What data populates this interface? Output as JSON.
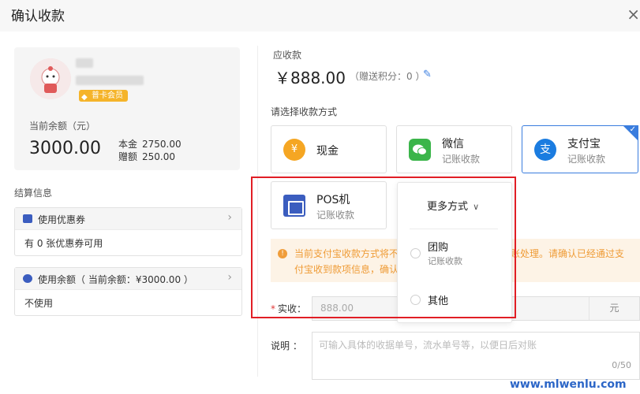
{
  "header": {
    "title": "确认收款",
    "close_label": "×"
  },
  "member": {
    "vip_label": "普卡会员",
    "balance_label": "当前余额（元）",
    "balance_value": "3000.00",
    "principal_label": "本金",
    "principal_value": "2750.00",
    "gift_label": "赠额",
    "gift_value": "250.00"
  },
  "settlement": {
    "label": "结算信息",
    "coupon": {
      "title": "使用优惠券",
      "body": "有 0 张优惠券可用"
    },
    "balance": {
      "title": "使用余额（ 当前余额：¥3000.00 ）",
      "body": "不使用"
    }
  },
  "due": {
    "label": "应收款",
    "amount": "￥888.00",
    "points": "（赠送积分：0 ）"
  },
  "payment": {
    "label": "请选择收款方式",
    "methods": [
      {
        "name": "现金",
        "sub": "",
        "icon": "yuan-icon",
        "color": "#f5a623"
      },
      {
        "name": "微信",
        "sub": "记账收款",
        "icon": "wechat-icon",
        "color": "#3bb54a"
      },
      {
        "name": "支付宝",
        "sub": "记账收款",
        "icon": "alipay-icon",
        "color": "#1b7ce0",
        "selected": true
      },
      {
        "name": "POS机",
        "sub": "记账收款",
        "icon": "pos-icon",
        "color": "#3b5dbf"
      }
    ],
    "more": {
      "label": "更多方式",
      "options": [
        {
          "name": "团购",
          "sub": "记账收款"
        },
        {
          "name": "其他",
          "sub": ""
        }
      ]
    }
  },
  "warning": {
    "text_a": "当前支付宝收款方式将不",
    "text_b": "付宝收到款项信息，确认",
    "text_c": "账处理。请确认已经通过支"
  },
  "form": {
    "amount_required": "*",
    "amount_label": "实收：",
    "amount_value": "888.00",
    "amount_unit": "元",
    "note_label": "说明 ：",
    "note_placeholder": "可输入具体的收据单号，流水单号等，以便日后对账",
    "note_count": "0/50"
  },
  "watermark": "www.mlwenlu.com"
}
